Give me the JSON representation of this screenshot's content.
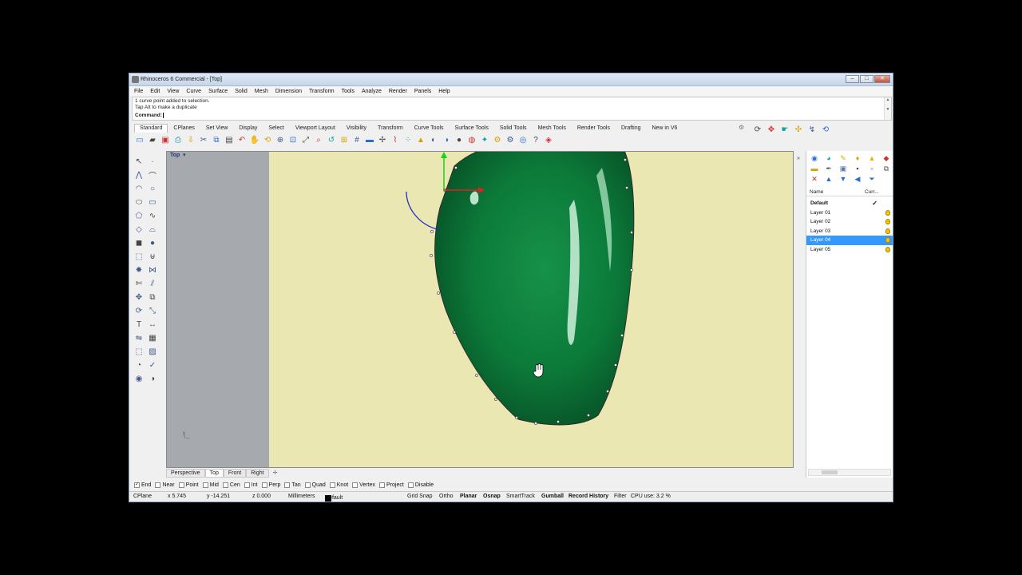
{
  "window": {
    "title": "Rhinoceros 6 Commercial - [Top]",
    "buttons": {
      "minimize": "–",
      "maximize": "□",
      "close": "✕"
    }
  },
  "menu": [
    "File",
    "Edit",
    "View",
    "Curve",
    "Surface",
    "Solid",
    "Mesh",
    "Dimension",
    "Transform",
    "Tools",
    "Analyze",
    "Render",
    "Panels",
    "Help"
  ],
  "command": {
    "history": [
      "1 curve point added to selection.",
      "Tap Alt to make a duplicate"
    ],
    "prompt": "Command:",
    "value": ""
  },
  "toolbar_tabs": [
    "Standard",
    "CPlanes",
    "Set View",
    "Display",
    "Select",
    "Viewport Layout",
    "Visibility",
    "Transform",
    "Curve Tools",
    "Surface Tools",
    "Solid Tools",
    "Mesh Tools",
    "Render Tools",
    "Drafting",
    "New in V6"
  ],
  "toolbar_icons": [
    "new-icon",
    "open-icon",
    "save-icon",
    "print-icon",
    "import-icon",
    "cut-icon",
    "copy-icon",
    "paste-icon",
    "undo-icon",
    "pan-icon",
    "rotate-view-icon",
    "zoom-dynamic-icon",
    "zoom-window-icon",
    "zoom-extents-icon",
    "zoom-selected-icon",
    "undo-view-icon",
    "four-viewports-icon",
    "grid-icon",
    "delete-icon",
    "select-points-icon",
    "select-curves-icon",
    "control-points-icon",
    "lock-icon",
    "display-mode-icon",
    "material-icon",
    "render-preview-icon",
    "sphere-icon",
    "light-icon",
    "gear-icon",
    "options-icon",
    "world-icon",
    "help-icon",
    "more-icon"
  ],
  "toolbar_right_icons": [
    "lasso-icon",
    "object-snap-icon",
    "hand-icon",
    "gumball-icon",
    "bolt-icon",
    "history-icon"
  ],
  "left_tools": [
    "select-arrow-icon",
    "point-icon",
    "polyline-icon",
    "curve-cv-icon",
    "arc-icon",
    "circle-icon",
    "ellipse-icon",
    "rectangle-icon",
    "polygon-icon",
    "free-form-curve-icon",
    "surface-icon",
    "loft-icon",
    "box-icon",
    "sphere-solid-icon",
    "extrude-icon",
    "boolean-icon",
    "explode-icon",
    "join-icon",
    "trim-icon",
    "split-icon",
    "move-icon",
    "copy-tool-icon",
    "rotate-icon",
    "scale-icon",
    "text-icon",
    "dimension-icon",
    "mirror-icon",
    "array-icon",
    "group-icon",
    "block-icon",
    "analyze-icon",
    "check-icon",
    "render-icon",
    "material-tool-icon"
  ],
  "viewport": {
    "label": "Top",
    "dropdown": "▾",
    "axis_label": "y"
  },
  "viewport_tabs": {
    "items": [
      "Perspective",
      "Top",
      "Front",
      "Right"
    ],
    "active": "Top",
    "add": "✛"
  },
  "osnap": [
    {
      "label": "End",
      "checked": true
    },
    {
      "label": "Near",
      "checked": false
    },
    {
      "label": "Point",
      "checked": false
    },
    {
      "label": "Mid",
      "checked": false
    },
    {
      "label": "Cen",
      "checked": false
    },
    {
      "label": "Int",
      "checked": false
    },
    {
      "label": "Perp",
      "checked": false
    },
    {
      "label": "Tan",
      "checked": false
    },
    {
      "label": "Quad",
      "checked": false
    },
    {
      "label": "Knot",
      "checked": false
    },
    {
      "label": "Vertex",
      "checked": false
    },
    {
      "label": "Project",
      "checked": false
    },
    {
      "label": "Disable",
      "checked": false
    }
  ],
  "status": {
    "cplane": "CPlane",
    "x": "x 5.745",
    "y": "y -14.251",
    "z": "z 0.000",
    "units": "Millimeters",
    "layer": "Default",
    "grid_snap": "Grid Snap",
    "ortho": "Ortho",
    "planar": "Planar",
    "osnap": "Osnap",
    "smarttrack": "SmartTrack",
    "gumball": "Gumball",
    "record_history": "Record History",
    "filter": "Filter",
    "cpu": "CPU use: 3.2 %"
  },
  "layers_panel": {
    "columns": {
      "name": "Name",
      "current": "Curr..."
    },
    "current_mark": "✓",
    "rows": [
      {
        "name": "Default",
        "current": true
      },
      {
        "name": "Layer 01"
      },
      {
        "name": "Layer 02"
      },
      {
        "name": "Layer 03"
      },
      {
        "name": "Layer 04",
        "selected": true
      },
      {
        "name": "Layer 05"
      }
    ],
    "collapse": "»"
  },
  "colors": {
    "gem": "#0d7a3a",
    "photo_background": "#ebe7b2",
    "viewport_bg": "#a6a9ae",
    "selection": "#3399ff"
  }
}
